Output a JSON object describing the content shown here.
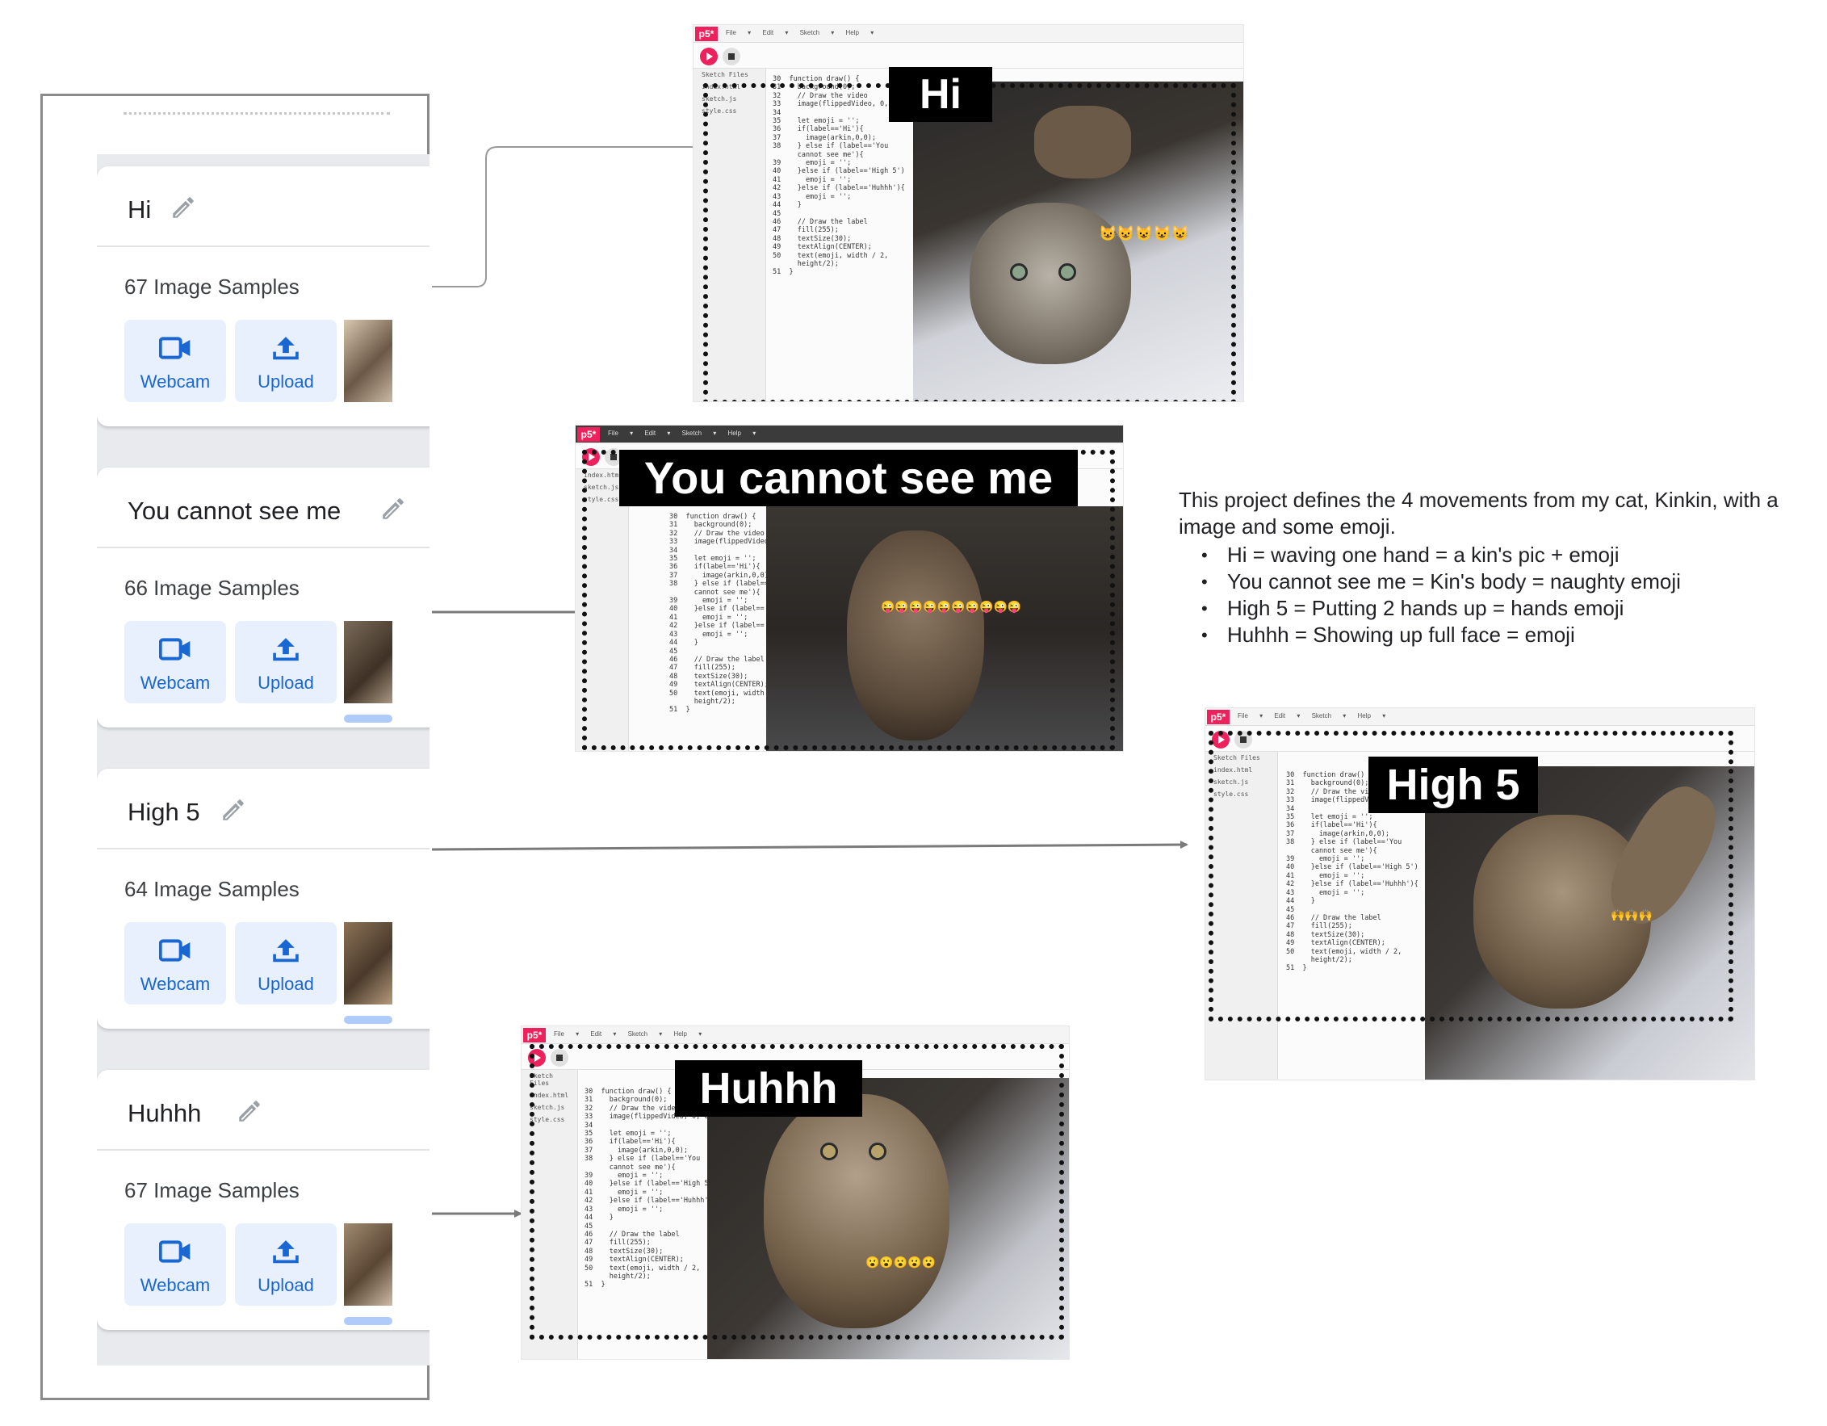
{
  "classes": [
    {
      "name": "Hi",
      "samples": "67 Image Samples",
      "webcam_label": "Webcam",
      "upload_label": "Upload"
    },
    {
      "name": "You cannot see me",
      "samples": "66 Image Samples",
      "webcam_label": "Webcam",
      "upload_label": "Upload"
    },
    {
      "name": "High 5",
      "samples": "64 Image Samples",
      "webcam_label": "Webcam",
      "upload_label": "Upload"
    },
    {
      "name": "Huhhh",
      "samples": "67 Image Samples",
      "webcam_label": "Webcam",
      "upload_label": "Upload"
    }
  ],
  "screenshots": {
    "labels": [
      "Hi",
      "You cannot see me",
      "High 5",
      "Huhhh"
    ],
    "logo": "p5*",
    "menu": "File ▾ Edit ▾ Sketch ▾ Help ▾",
    "files": [
      "Sketch Files",
      "index.html",
      "sketch.js",
      "style.css"
    ],
    "code_lines": [
      "30  function draw() {",
      "31    background(0);",
      "32    // Draw the video",
      "33    image(flippedVideo, 0, 0);",
      "34",
      "35    let emoji = '';",
      "36    if(label=='Hi'){",
      "37      image(arkin,0,0);",
      "38    } else if (label=='You",
      "      cannot see me'){",
      "39      emoji = '';",
      "40    }else if (label=='High 5')",
      "41      emoji = '';",
      "42    }else if (label=='Huhhh'){",
      "43      emoji = '';",
      "44    }",
      "45",
      "46    // Draw the label",
      "47    fill(255);",
      "48    textSize(30);",
      "49    textAlign(CENTER);",
      "50    text(emoji, width / 2,",
      "      height/2);",
      "51  }"
    ],
    "emojis": [
      "😺😺😺😺😺",
      "😜😜😜😜😜😜😜😜😜😜",
      "🙌🙌🙌",
      "😮😮😮😮😮"
    ]
  },
  "description": {
    "intro": "This project defines the 4 movements from my cat, Kinkin, with a image and some emoji.",
    "items": [
      "Hi = waving one hand = a kin's pic + emoji",
      "You cannot see me = Kin's body = naughty emoji",
      "High 5 = Putting 2 hands up = hands emoji",
      "Huhhh = Showing up full face = emoji"
    ]
  },
  "icons": {
    "pencil": "pencil-icon",
    "webcam": "webcam-icon",
    "upload": "upload-icon"
  },
  "colors": {
    "accent": "#1967d2",
    "button_bg": "#e8f0fe",
    "p5": "#ed225d"
  }
}
